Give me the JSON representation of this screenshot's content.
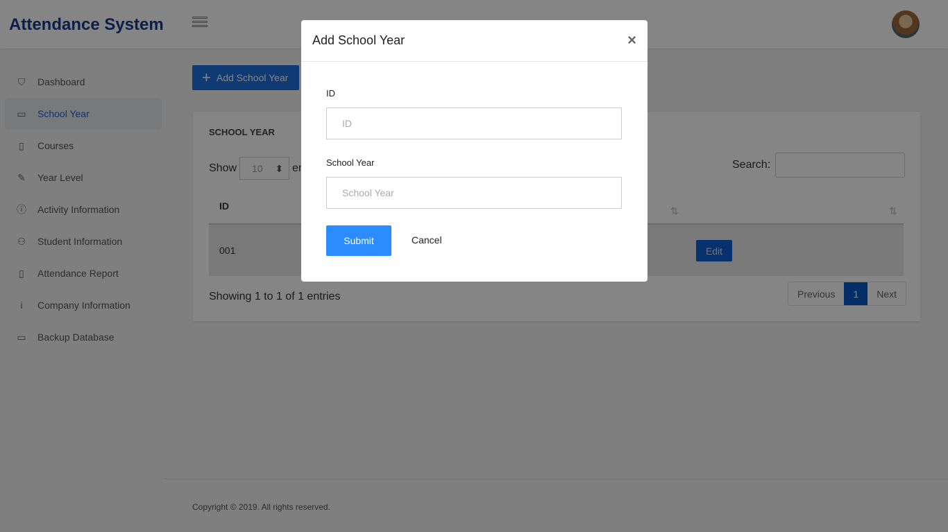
{
  "app": {
    "title": "Attendance System"
  },
  "sidebar": {
    "items": [
      {
        "label": "Dashboard",
        "icon": "shield-icon",
        "glyph": "⛉"
      },
      {
        "label": "School Year",
        "icon": "calendar-icon",
        "glyph": "▭",
        "active": true
      },
      {
        "label": "Courses",
        "icon": "book-icon",
        "glyph": "▯"
      },
      {
        "label": "Year Level",
        "icon": "pencil-icon",
        "glyph": "✎"
      },
      {
        "label": "Activity Information",
        "icon": "info-circle-icon",
        "glyph": "ⓘ"
      },
      {
        "label": "Student Information",
        "icon": "user-icon",
        "glyph": "⚇"
      },
      {
        "label": "Attendance Report",
        "icon": "file-icon",
        "glyph": "▯"
      },
      {
        "label": "Company Information",
        "icon": "info-icon",
        "glyph": "i"
      },
      {
        "label": "Backup Database",
        "icon": "drive-icon",
        "glyph": "▭"
      }
    ]
  },
  "main": {
    "add_button": "Add School Year",
    "card_title": "SCHOOL YEAR",
    "show_label": "Show",
    "entries_label": "en",
    "page_length": "10",
    "search_label": "Search:",
    "columns": [
      "ID"
    ],
    "rows": [
      {
        "id": "001",
        "action": "Edit"
      }
    ],
    "info": "Showing 1 to 1 of 1 entries",
    "pagination": {
      "previous": "Previous",
      "current": "1",
      "next": "Next"
    }
  },
  "footer": {
    "text": "Copyright © 2019. All rights reserved."
  },
  "modal": {
    "title": "Add School Year",
    "close": "×",
    "id_label": "ID",
    "id_placeholder": "ID",
    "year_label": "School Year",
    "year_placeholder": "School Year",
    "submit": "Submit",
    "cancel": "Cancel"
  }
}
